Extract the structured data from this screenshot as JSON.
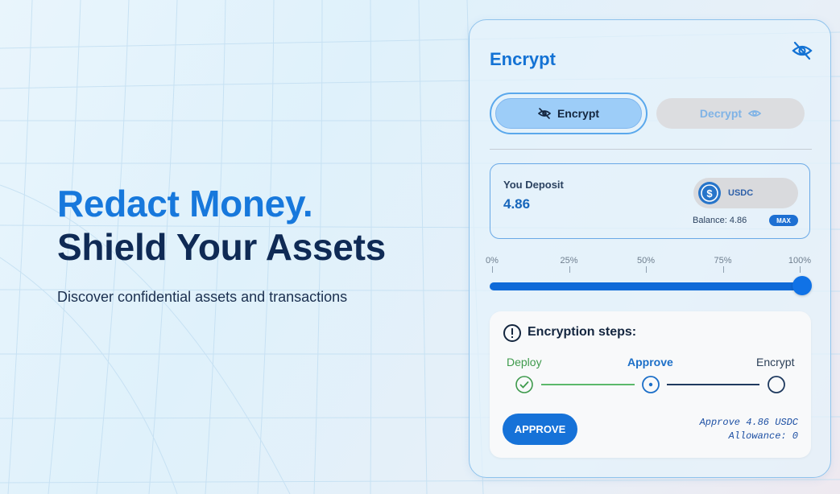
{
  "hero": {
    "line1": "Redact Money.",
    "line2": "Shield Your Assets",
    "subtitle": "Discover confidential assets and transactions"
  },
  "card": {
    "title": "Encrypt",
    "hide_icon": "eye-off-icon",
    "modes": {
      "encrypt_label": "Encrypt",
      "encrypt_icon": "eye-off-icon",
      "decrypt_label": "Decrypt",
      "decrypt_icon": "eye-icon",
      "active": "Encrypt"
    },
    "deposit": {
      "label": "You Deposit",
      "amount": "4.86",
      "token": "USDC",
      "token_icon": "usdc-logo",
      "balance": "Balance: 4.86",
      "max_label": "MAX"
    },
    "slider": {
      "ticks": [
        "0%",
        "25%",
        "50%",
        "75%",
        "100%"
      ],
      "percent": 100
    },
    "steps": {
      "title": "Encryption steps:",
      "items": [
        {
          "label": "Deploy",
          "status": "done"
        },
        {
          "label": "Approve",
          "status": "current"
        },
        {
          "label": "Encrypt",
          "status": "pending"
        }
      ],
      "action_label": "APPROVE",
      "note_line1": "Approve 4.86 USDC",
      "note_line2": "Allowance: 0"
    }
  },
  "colors": {
    "accent": "#1778dc",
    "navy": "#0f2a55",
    "done_green": "#3e9a4c"
  }
}
